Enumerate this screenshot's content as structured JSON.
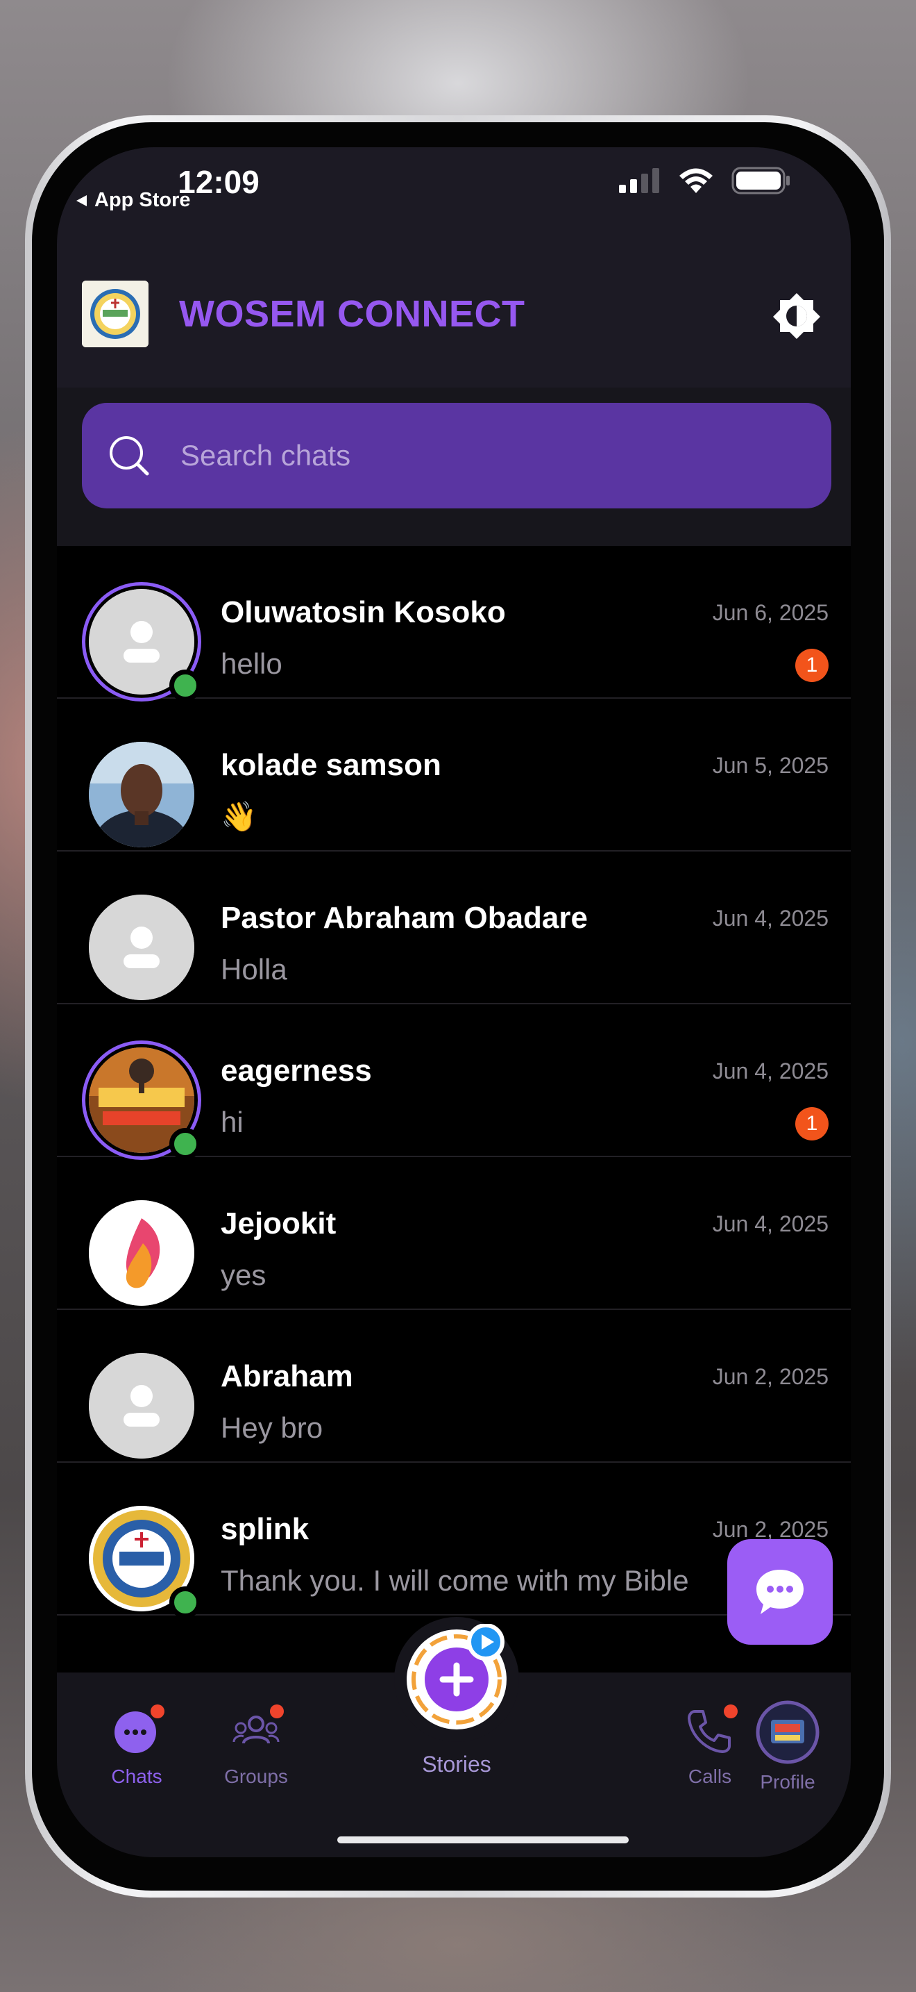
{
  "status_bar": {
    "time": "12:09",
    "back_app": "App Store"
  },
  "header": {
    "title": "WOSEM CONNECT"
  },
  "search": {
    "placeholder": "Search chats"
  },
  "chats": [
    {
      "name": "Oluwatosin Kosoko",
      "preview": "hello",
      "date": "Jun 6, 2025",
      "unread": "1",
      "online": true,
      "story_ring": true,
      "avatar": "default"
    },
    {
      "name": "kolade samson",
      "preview": "👋",
      "date": "Jun 5, 2025",
      "unread": "",
      "online": false,
      "story_ring": false,
      "avatar": "photo"
    },
    {
      "name": "Pastor Abraham Obadare",
      "preview": "Holla",
      "date": "Jun 4, 2025",
      "unread": "",
      "online": false,
      "story_ring": false,
      "avatar": "default"
    },
    {
      "name": "eagerness",
      "preview": "hi",
      "date": "Jun 4, 2025",
      "unread": "1",
      "online": true,
      "story_ring": true,
      "avatar": "radio"
    },
    {
      "name": "Jejookit",
      "preview": "yes",
      "date": "Jun 4, 2025",
      "unread": "",
      "online": false,
      "story_ring": false,
      "avatar": "flame"
    },
    {
      "name": "Abraham",
      "preview": "Hey bro",
      "date": "Jun 2, 2025",
      "unread": "",
      "online": false,
      "story_ring": false,
      "avatar": "default"
    },
    {
      "name": "splink",
      "preview": "Thank you. I will come with my Bible",
      "date": "Jun 2, 2025",
      "unread": "",
      "online": true,
      "story_ring": false,
      "avatar": "church"
    }
  ],
  "nav": {
    "chats": "Chats",
    "groups": "Groups",
    "stories": "Stories",
    "calls": "Calls",
    "profile": "Profile"
  },
  "colors": {
    "accent": "#9658f0",
    "search_bg": "#5a35a2",
    "badge": "#f2541b",
    "online": "#3fb34f"
  }
}
